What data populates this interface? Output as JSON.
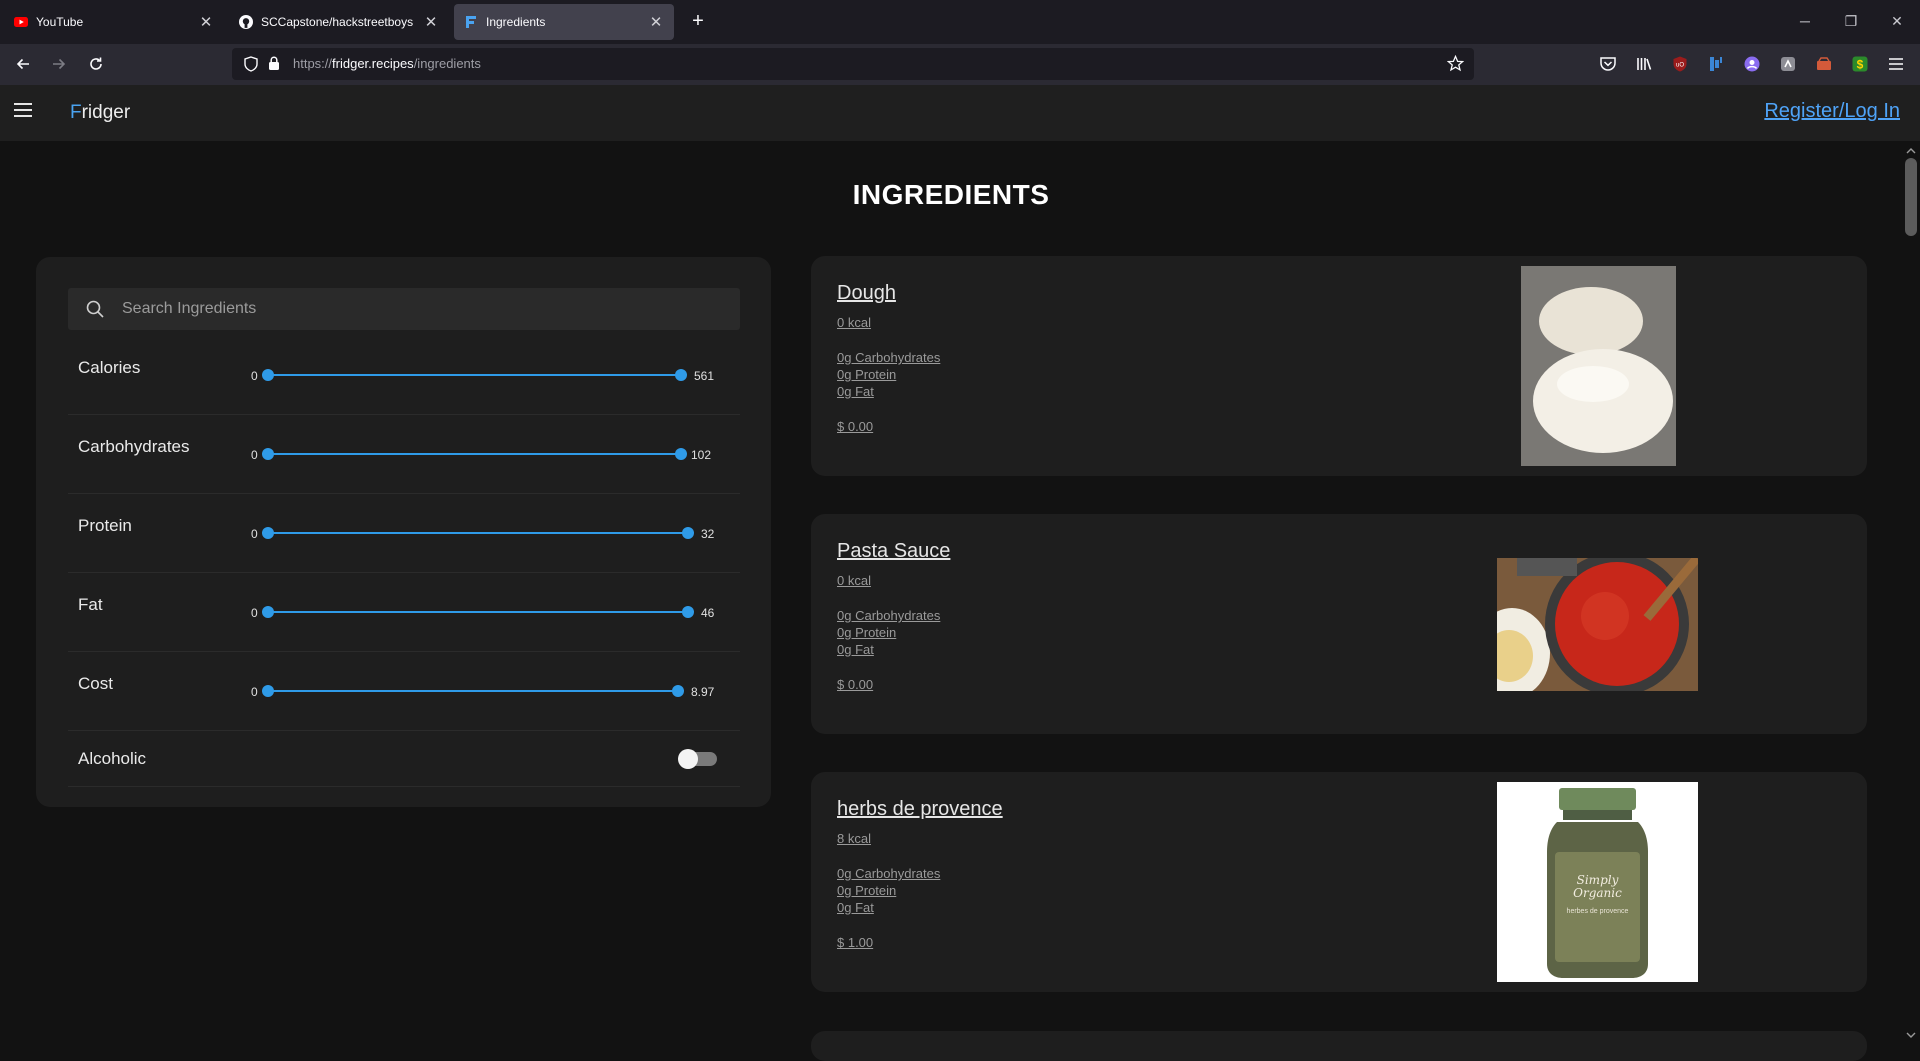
{
  "browser": {
    "tabs": [
      {
        "title": "YouTube",
        "icon": "youtube-icon"
      },
      {
        "title": "SCCapstone/hackstreetboys",
        "icon": "github-icon"
      },
      {
        "title": "Ingredients",
        "icon": "fridger-icon",
        "active": true
      }
    ],
    "url_scheme": "https://",
    "url_host": "fridger.recipes",
    "url_path": "/ingredients"
  },
  "app": {
    "brand_first": "F",
    "brand_rest": "ridger",
    "login_label": "Register/Log In",
    "page_title": "INGREDIENTS"
  },
  "filters": {
    "search_placeholder": "Search Ingredients",
    "sliders": [
      {
        "label": "Calories",
        "min": "0",
        "max": "561"
      },
      {
        "label": "Carbohydrates",
        "min": "0",
        "max": "102"
      },
      {
        "label": "Protein",
        "min": "0",
        "max": "32"
      },
      {
        "label": "Fat",
        "min": "0",
        "max": "46"
      },
      {
        "label": "Cost",
        "min": "0",
        "max": "8.97"
      }
    ],
    "alcoholic": {
      "label": "Alcoholic",
      "checked": false
    }
  },
  "ingredients": [
    {
      "name": "Dough",
      "kcal": "0 kcal",
      "carbs": "0g Carbohydrates",
      "protein": "0g Protein",
      "fat": "0g Fat",
      "cost": "$ 0.00"
    },
    {
      "name": "Pasta Sauce",
      "kcal": "0 kcal",
      "carbs": "0g Carbohydrates",
      "protein": "0g Protein",
      "fat": "0g Fat",
      "cost": "$ 0.00"
    },
    {
      "name": "herbs de provence",
      "kcal": "8 kcal",
      "carbs": "0g Carbohydrates",
      "protein": "0g Protein",
      "fat": "0g Fat",
      "cost": "$ 1.00"
    }
  ],
  "jar_label": {
    "brand": "Simply Organic",
    "product": "herbes de provence"
  },
  "colors": {
    "accent": "#2f9be8",
    "link": "#4fa3f7",
    "background": "#121212",
    "card": "#1e1e1e"
  }
}
